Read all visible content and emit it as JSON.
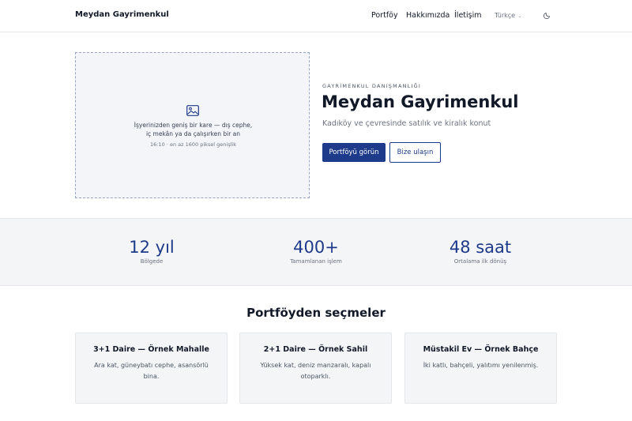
{
  "header": {
    "brand": "Meydan Gayrimenkul",
    "nav": [
      "Portföy",
      "Hakkımızda",
      "İletişim"
    ],
    "language": "Türkçe"
  },
  "hero": {
    "placeholder_text": "İşyerinizden geniş bir kare — dış cephe, iç mekân ya da çalışırken bir an",
    "placeholder_sub": "16:10 · en az 1600 piksel genişlik",
    "eyebrow": "GAYRİMENKUL DANIŞMANLIĞI",
    "title": "Meydan Gayrimenkul",
    "subtitle": "Kadıköy ve çevresinde satılık ve kiralık konut",
    "primary_button": "Portföyü görün",
    "secondary_button": "Bize ulaşın"
  },
  "stats": [
    {
      "value": "12 yıl",
      "label": "Bölgede"
    },
    {
      "value": "400+",
      "label": "Tamamlanan işlem"
    },
    {
      "value": "48 saat",
      "label": "Ortalama ilk dönüş"
    }
  ],
  "portfolio": {
    "title": "Portföyden seçmeler",
    "cards": [
      {
        "title": "3+1 Daire — Örnek Mahalle",
        "desc": "Ara kat, güneybatı cephe, asansörlü bina."
      },
      {
        "title": "2+1 Daire — Örnek Sahil",
        "desc": "Yüksek kat, deniz manzaralı, kapalı otoparklı."
      },
      {
        "title": "Müstakil Ev — Örnek Bahçe",
        "desc": "İki katlı, bahçeli, yalıtımı yenilenmiş."
      }
    ]
  },
  "colors": {
    "accent": "#1e3a8a"
  }
}
